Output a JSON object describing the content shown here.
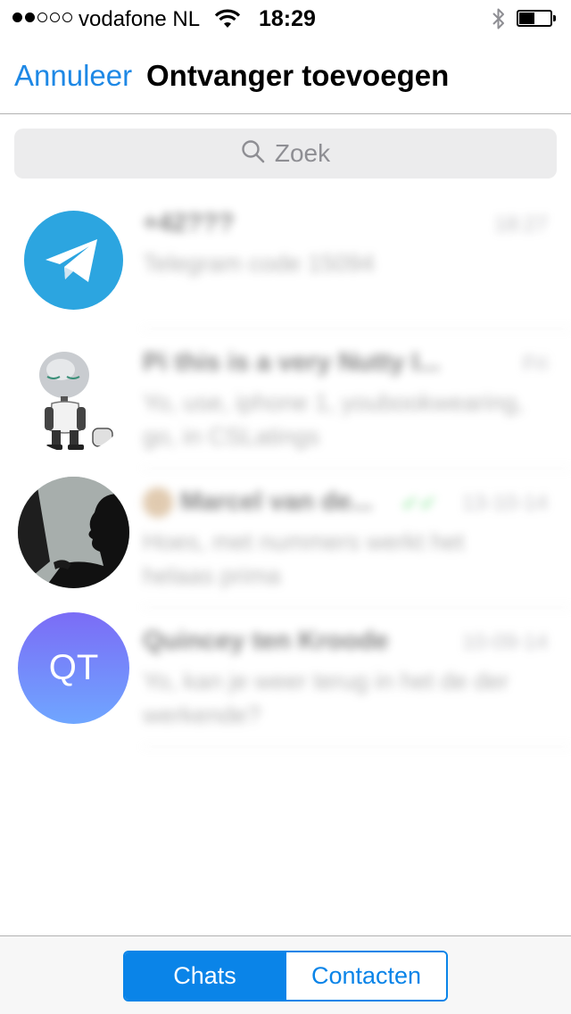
{
  "status_bar": {
    "signal_strength": "2 of 5",
    "carrier": "vodafone NL",
    "wifi_icon": "wifi-icon",
    "time": "18:29",
    "bluetooth_icon": "bluetooth-icon",
    "battery_level": 0.4
  },
  "nav": {
    "cancel_label": "Annuleer",
    "title": "Ontvanger toevoegen"
  },
  "search": {
    "icon": "search-icon",
    "placeholder": "Zoek"
  },
  "chats": [
    {
      "avatar": "telegram-logo",
      "name": "+42???",
      "time": "18:27",
      "preview": "Telegram code 15094"
    },
    {
      "avatar": "robot-avatar",
      "name": "Pi this is a very Nutty I...",
      "time": "Fri",
      "preview": "Yo, use, iphone 1, youbookwearing, go, in CSLatings"
    },
    {
      "avatar": "silhouette-photo",
      "name": "Marcel van de...",
      "time": "13-10-14",
      "preview": "Hoes, met nummers werkt het helaas prima"
    },
    {
      "avatar_initials": "QT",
      "name": "Quincey ten Kroode",
      "time": "10-09-14",
      "preview": "Yo, kan je weer terug in het de der werkende?"
    }
  ],
  "tabs": {
    "chats_label": "Chats",
    "contacts_label": "Contacten",
    "active": "Chats"
  },
  "colors": {
    "accent": "#1e88e5",
    "segment": "#0a84e8",
    "telegram": "#2ca5e0",
    "qt_gradient_top": "#7b6cf6",
    "qt_gradient_bottom": "#6fa6ff"
  }
}
